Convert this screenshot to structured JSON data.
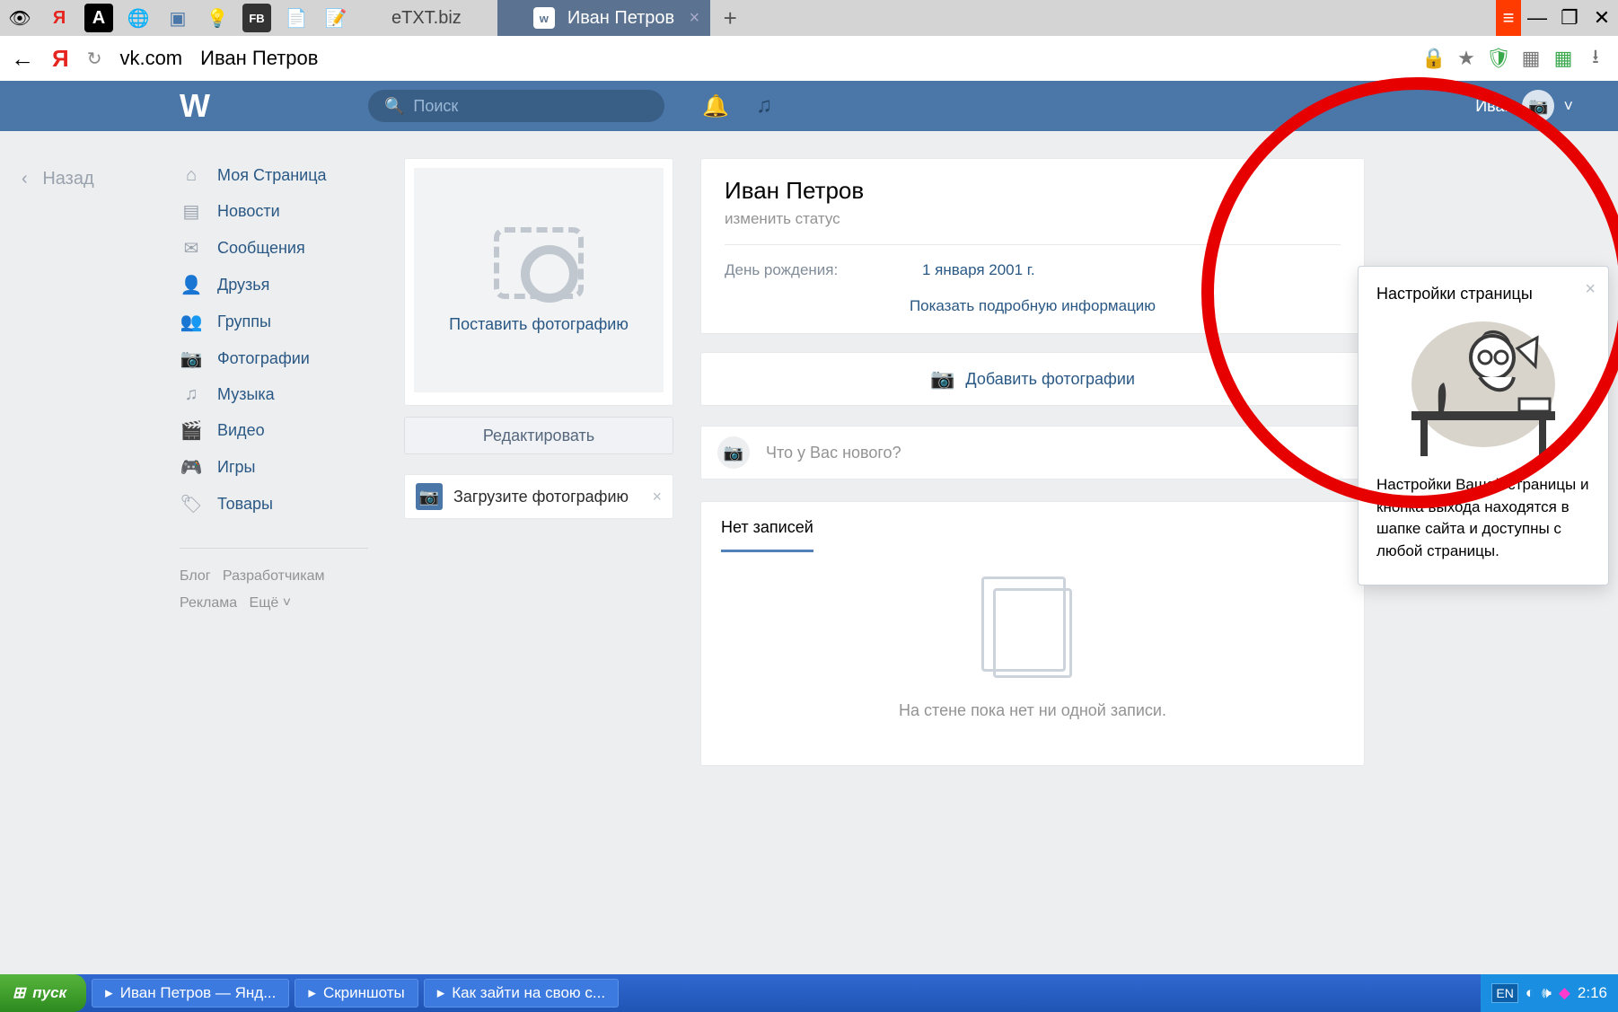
{
  "browser": {
    "tabs": [
      {
        "label": "eTXT.biz"
      },
      {
        "label": "Иван Петров"
      }
    ],
    "new_tab": "+",
    "close": "×",
    "url_domain": "vk.com",
    "url_title": "Иван Петров",
    "win_min": "—",
    "win_max": "❐",
    "win_close": "✕"
  },
  "header": {
    "search_placeholder": "Поиск",
    "user_name": "Иван"
  },
  "back_label": "Назад",
  "sidebar": {
    "items": [
      {
        "icon": "home-icon",
        "glyph": "⌂",
        "label": "Моя Страница"
      },
      {
        "icon": "news-icon",
        "glyph": "▤",
        "label": "Новости"
      },
      {
        "icon": "messages-icon",
        "glyph": "✉",
        "label": "Сообщения"
      },
      {
        "icon": "friends-icon",
        "glyph": "👤",
        "label": "Друзья"
      },
      {
        "icon": "groups-icon",
        "glyph": "👥",
        "label": "Группы"
      },
      {
        "icon": "photos-icon",
        "glyph": "📷",
        "label": "Фотографии"
      },
      {
        "icon": "music-icon",
        "glyph": "♫",
        "label": "Музыка"
      },
      {
        "icon": "video-icon",
        "glyph": "🎬",
        "label": "Видео"
      },
      {
        "icon": "games-icon",
        "glyph": "🎮",
        "label": "Игры"
      },
      {
        "icon": "market-icon",
        "glyph": "🏷",
        "label": "Товары"
      }
    ],
    "footer": {
      "blog": "Блог",
      "dev": "Разработчикам",
      "ads": "Реклама",
      "more": "Ещё ˅"
    }
  },
  "profile": {
    "upload_photo": "Поставить фотографию",
    "edit": "Редактировать",
    "upload_card": "Загрузите фотографию"
  },
  "main": {
    "name": "Иван Петров",
    "status": "изменить статус",
    "birthday_label": "День рождения:",
    "birthday_value": "1 января 2001 г.",
    "show_more": "Показать подробную информацию",
    "add_photos": "Добавить фотографии",
    "new_post_placeholder": "Что у Вас нового?",
    "tab_no_posts": "Нет записей",
    "empty_wall": "На стене пока нет ни одной записи."
  },
  "popup": {
    "title": "Настройки страницы",
    "text": "Настройки Вашей страницы и кнопка выхода находятся в шапке сайта и доступны с любой страницы."
  },
  "taskbar": {
    "start": "пуск",
    "items": [
      "Иван Петров — Янд...",
      "Скриншоты",
      "Как зайти на свою с..."
    ],
    "lang": "EN",
    "time": "2:16"
  }
}
